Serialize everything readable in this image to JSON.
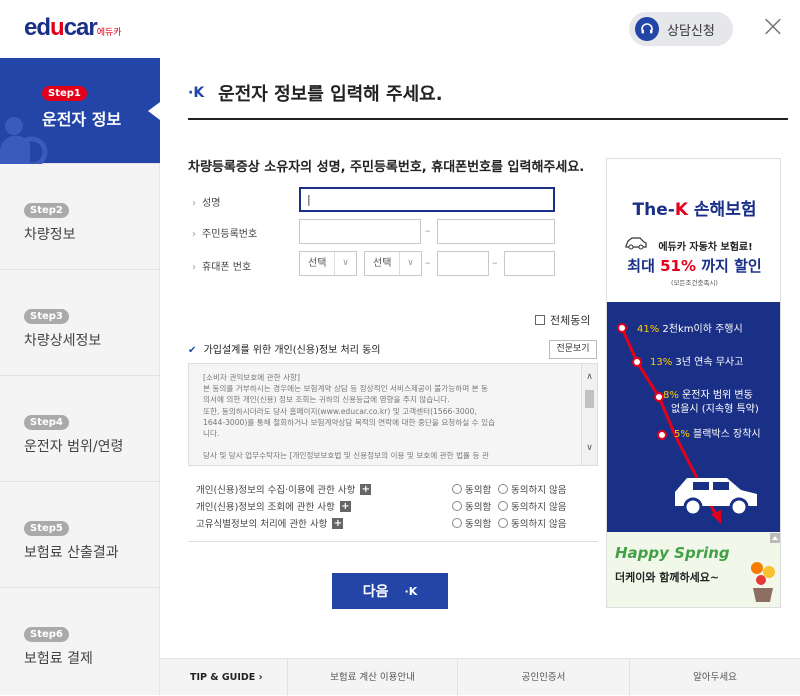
{
  "header": {
    "logo_prefix": "ed",
    "logo_red": "u",
    "logo_suffix": "car",
    "logo_small": "에듀카",
    "consult_label": "상담신청",
    "close_label": "×"
  },
  "sidebar": {
    "steps": [
      {
        "badge": "Step1",
        "label": "운전자 정보",
        "active": true
      },
      {
        "badge": "Step2",
        "label": "차량정보"
      },
      {
        "badge": "Step3",
        "label": "차량상세정보"
      },
      {
        "badge": "Step4",
        "label": "운전자 범위/연령"
      },
      {
        "badge": "Step5",
        "label": "보험료 산출결과"
      },
      {
        "badge": "Step6",
        "label": "보험료 결제"
      }
    ]
  },
  "main": {
    "title_icon": "·K",
    "title": "운전자 정보를 입력해 주세요.",
    "description": "차량등록증상 소유자의 성명, 주민등록번호, 휴대폰번호를 입력해주세요.",
    "fields": {
      "name_label": "성명",
      "name_value": "|",
      "rrn_label": "주민등록번호",
      "phone_label": "휴대폰 번호",
      "select1": "선택",
      "select2": "선택",
      "dash": "–"
    },
    "agree_all": "전체동의",
    "consent_title": "가입설계를 위한 개인(신용)정보 처리 동의",
    "consent_check": "✔",
    "full_view": "전문보기",
    "consent_lines": [
      "[소비자 권익보호에 관한 사항]",
      "  본 동의를 거부하시는 경우에는 보험계약 상담 등 정상적인 서비스제공이 불가능하며 본 동",
      "의서에 의한 개인(신용) 정보 조회는 귀하의 신용등급에 영향을 주지 않습니다.",
      "또한, 동의하시더라도 당사 홈페이지(www.educar.co.kr) 및 고객센터(1566-3000,",
      "1644-3000)를 통해 철회하거나 보험계약상담 목적의 연락에 대한 중단을 요청하실 수 있습",
      "니다.",
      "",
      "  당사 및 당사 업무수탁자는 [개인정보보호법 및 신용정보의 이용 및 보호에 관한 법률 등 관"
    ],
    "consent_rows": [
      {
        "label": "개인(신용)정보의 수집·이용에 관한 사항"
      },
      {
        "label": "개인(신용)정보의 조회에 관한 사항"
      },
      {
        "label": "고유식별정보의 처리에 관한 사항"
      }
    ],
    "agree_label": "동의함",
    "disagree_label": "동의하지 않음",
    "plus": "+",
    "next_label": "다음",
    "next_icon": "·K"
  },
  "ad": {
    "brand_prefix": "The-",
    "brand_k": "K",
    "brand_suffix": " 손해보험",
    "sub": "에듀카 자동차 보험료!",
    "discount_prefix": "최대 ",
    "discount_pct": "51%",
    "discount_suffix": " 까지 할인",
    "note": "(모든조건충족시)",
    "bullets": [
      {
        "hl": "41%",
        "text": " 2천km이하 주행시"
      },
      {
        "hl": "13%",
        "text": " 3년 연속 무사고"
      },
      {
        "hl": "8%",
        "text": " 운전자 범위 변동",
        "text2": "없을시 (지속형 특약)"
      },
      {
        "hl": "5%",
        "text": " 블랙박스 장착시"
      }
    ],
    "happy": "Happy Spring",
    "happy_sub": "더케이와 함께하세요~"
  },
  "footer": {
    "items": [
      "TIP & GUIDE  ›",
      "보험료 계산 이용안내",
      "공인인증서",
      "알아두세요"
    ]
  },
  "colors": {
    "primary": "#2345a8",
    "navy": "#1a2f86",
    "accent": "#e3001b"
  }
}
